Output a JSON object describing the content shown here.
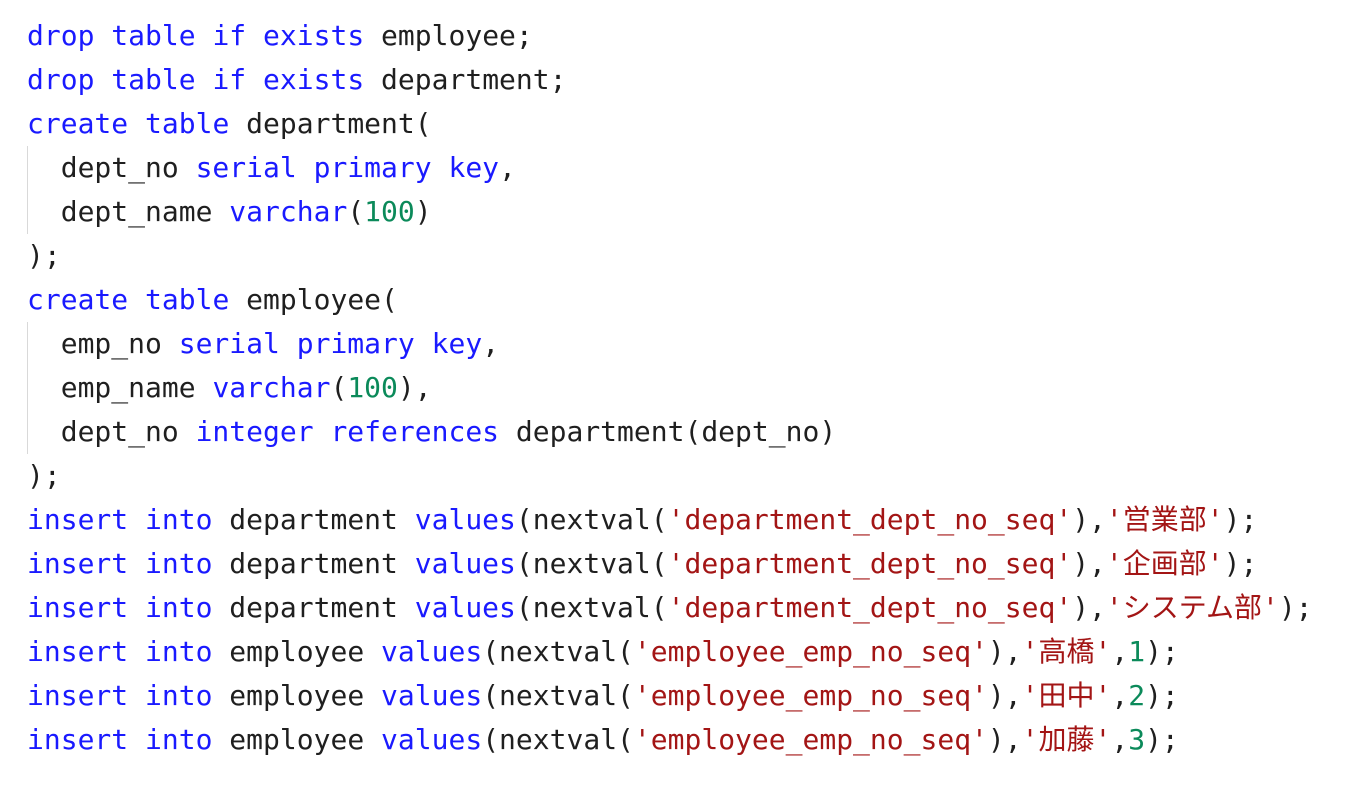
{
  "colors": {
    "keyword": "#1a1aff",
    "string": "#a31515",
    "number": "#0b8a5a",
    "text": "#1f1f1f",
    "indent_guide": "#d9d9d9",
    "background": "#ffffff"
  },
  "code": {
    "language": "SQL",
    "lines": [
      {
        "indent": false,
        "tokens": [
          {
            "t": "kw",
            "v": "drop"
          },
          {
            "t": "plain",
            "v": " "
          },
          {
            "t": "kw",
            "v": "table"
          },
          {
            "t": "plain",
            "v": " "
          },
          {
            "t": "kw",
            "v": "if"
          },
          {
            "t": "plain",
            "v": " "
          },
          {
            "t": "kw",
            "v": "exists"
          },
          {
            "t": "plain",
            "v": " employee;"
          }
        ]
      },
      {
        "indent": false,
        "tokens": [
          {
            "t": "kw",
            "v": "drop"
          },
          {
            "t": "plain",
            "v": " "
          },
          {
            "t": "kw",
            "v": "table"
          },
          {
            "t": "plain",
            "v": " "
          },
          {
            "t": "kw",
            "v": "if"
          },
          {
            "t": "plain",
            "v": " "
          },
          {
            "t": "kw",
            "v": "exists"
          },
          {
            "t": "plain",
            "v": " department;"
          }
        ]
      },
      {
        "indent": false,
        "tokens": [
          {
            "t": "kw",
            "v": "create"
          },
          {
            "t": "plain",
            "v": " "
          },
          {
            "t": "kw",
            "v": "table"
          },
          {
            "t": "plain",
            "v": " department("
          }
        ]
      },
      {
        "indent": true,
        "tokens": [
          {
            "t": "plain",
            "v": "  dept_no "
          },
          {
            "t": "kw",
            "v": "serial"
          },
          {
            "t": "plain",
            "v": " "
          },
          {
            "t": "kw",
            "v": "primary"
          },
          {
            "t": "plain",
            "v": " "
          },
          {
            "t": "kw",
            "v": "key"
          },
          {
            "t": "plain",
            "v": ","
          }
        ]
      },
      {
        "indent": true,
        "tokens": [
          {
            "t": "plain",
            "v": "  dept_name "
          },
          {
            "t": "kw",
            "v": "varchar"
          },
          {
            "t": "plain",
            "v": "("
          },
          {
            "t": "num",
            "v": "100"
          },
          {
            "t": "plain",
            "v": ")"
          }
        ]
      },
      {
        "indent": false,
        "tokens": [
          {
            "t": "plain",
            "v": ");"
          }
        ]
      },
      {
        "indent": false,
        "tokens": [
          {
            "t": "kw",
            "v": "create"
          },
          {
            "t": "plain",
            "v": " "
          },
          {
            "t": "kw",
            "v": "table"
          },
          {
            "t": "plain",
            "v": " employee("
          }
        ]
      },
      {
        "indent": true,
        "tokens": [
          {
            "t": "plain",
            "v": "  emp_no "
          },
          {
            "t": "kw",
            "v": "serial"
          },
          {
            "t": "plain",
            "v": " "
          },
          {
            "t": "kw",
            "v": "primary"
          },
          {
            "t": "plain",
            "v": " "
          },
          {
            "t": "kw",
            "v": "key"
          },
          {
            "t": "plain",
            "v": ","
          }
        ]
      },
      {
        "indent": true,
        "tokens": [
          {
            "t": "plain",
            "v": "  emp_name "
          },
          {
            "t": "kw",
            "v": "varchar"
          },
          {
            "t": "plain",
            "v": "("
          },
          {
            "t": "num",
            "v": "100"
          },
          {
            "t": "plain",
            "v": "),"
          }
        ]
      },
      {
        "indent": true,
        "tokens": [
          {
            "t": "plain",
            "v": "  dept_no "
          },
          {
            "t": "kw",
            "v": "integer"
          },
          {
            "t": "plain",
            "v": " "
          },
          {
            "t": "kw",
            "v": "references"
          },
          {
            "t": "plain",
            "v": " department(dept_no)"
          }
        ]
      },
      {
        "indent": false,
        "tokens": [
          {
            "t": "plain",
            "v": ");"
          }
        ]
      },
      {
        "indent": false,
        "tokens": [
          {
            "t": "kw",
            "v": "insert"
          },
          {
            "t": "plain",
            "v": " "
          },
          {
            "t": "kw",
            "v": "into"
          },
          {
            "t": "plain",
            "v": " department "
          },
          {
            "t": "kw",
            "v": "values"
          },
          {
            "t": "plain",
            "v": "(nextval("
          },
          {
            "t": "str",
            "v": "'department_dept_no_seq'"
          },
          {
            "t": "plain",
            "v": "),"
          },
          {
            "t": "str",
            "v": "'営業部'"
          },
          {
            "t": "plain",
            "v": ");"
          }
        ]
      },
      {
        "indent": false,
        "tokens": [
          {
            "t": "kw",
            "v": "insert"
          },
          {
            "t": "plain",
            "v": " "
          },
          {
            "t": "kw",
            "v": "into"
          },
          {
            "t": "plain",
            "v": " department "
          },
          {
            "t": "kw",
            "v": "values"
          },
          {
            "t": "plain",
            "v": "(nextval("
          },
          {
            "t": "str",
            "v": "'department_dept_no_seq'"
          },
          {
            "t": "plain",
            "v": "),"
          },
          {
            "t": "str",
            "v": "'企画部'"
          },
          {
            "t": "plain",
            "v": ");"
          }
        ]
      },
      {
        "indent": false,
        "tokens": [
          {
            "t": "kw",
            "v": "insert"
          },
          {
            "t": "plain",
            "v": " "
          },
          {
            "t": "kw",
            "v": "into"
          },
          {
            "t": "plain",
            "v": " department "
          },
          {
            "t": "kw",
            "v": "values"
          },
          {
            "t": "plain",
            "v": "(nextval("
          },
          {
            "t": "str",
            "v": "'department_dept_no_seq'"
          },
          {
            "t": "plain",
            "v": "),"
          },
          {
            "t": "str",
            "v": "'システム部'"
          },
          {
            "t": "plain",
            "v": ");"
          }
        ]
      },
      {
        "indent": false,
        "tokens": [
          {
            "t": "kw",
            "v": "insert"
          },
          {
            "t": "plain",
            "v": " "
          },
          {
            "t": "kw",
            "v": "into"
          },
          {
            "t": "plain",
            "v": " employee "
          },
          {
            "t": "kw",
            "v": "values"
          },
          {
            "t": "plain",
            "v": "(nextval("
          },
          {
            "t": "str",
            "v": "'employee_emp_no_seq'"
          },
          {
            "t": "plain",
            "v": "),"
          },
          {
            "t": "str",
            "v": "'高橋'"
          },
          {
            "t": "plain",
            "v": ","
          },
          {
            "t": "num",
            "v": "1"
          },
          {
            "t": "plain",
            "v": ");"
          }
        ]
      },
      {
        "indent": false,
        "tokens": [
          {
            "t": "kw",
            "v": "insert"
          },
          {
            "t": "plain",
            "v": " "
          },
          {
            "t": "kw",
            "v": "into"
          },
          {
            "t": "plain",
            "v": " employee "
          },
          {
            "t": "kw",
            "v": "values"
          },
          {
            "t": "plain",
            "v": "(nextval("
          },
          {
            "t": "str",
            "v": "'employee_emp_no_seq'"
          },
          {
            "t": "plain",
            "v": "),"
          },
          {
            "t": "str",
            "v": "'田中'"
          },
          {
            "t": "plain",
            "v": ","
          },
          {
            "t": "num",
            "v": "2"
          },
          {
            "t": "plain",
            "v": ");"
          }
        ]
      },
      {
        "indent": false,
        "tokens": [
          {
            "t": "kw",
            "v": "insert"
          },
          {
            "t": "plain",
            "v": " "
          },
          {
            "t": "kw",
            "v": "into"
          },
          {
            "t": "plain",
            "v": " employee "
          },
          {
            "t": "kw",
            "v": "values"
          },
          {
            "t": "plain",
            "v": "(nextval("
          },
          {
            "t": "str",
            "v": "'employee_emp_no_seq'"
          },
          {
            "t": "plain",
            "v": "),"
          },
          {
            "t": "str",
            "v": "'加藤'"
          },
          {
            "t": "plain",
            "v": ","
          },
          {
            "t": "num",
            "v": "3"
          },
          {
            "t": "plain",
            "v": ");"
          }
        ]
      }
    ]
  }
}
